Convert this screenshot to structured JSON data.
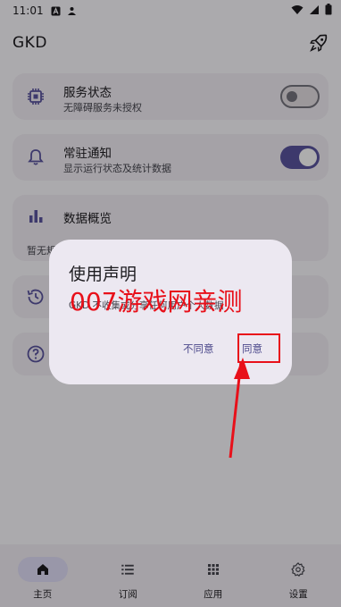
{
  "status_bar": {
    "time": "11:01"
  },
  "app_bar": {
    "title": "GKD"
  },
  "cards": {
    "service": {
      "label": "服务状态",
      "sub": "无障碍服务未授权"
    },
    "notify": {
      "label": "常驻通知",
      "sub": "显示运行状态及统计数据"
    },
    "overview": {
      "label": "数据概览",
      "sub": "暂无规"
    }
  },
  "dialog": {
    "title": "使用声明",
    "body": "GKD 不收集或分享任何用户个人数据",
    "disagree": "不同意",
    "agree": "同意"
  },
  "watermark": "007游戏网亲测",
  "bottom_nav": {
    "home": "主页",
    "subscribe": "订阅",
    "apps": "应用",
    "settings": "设置"
  },
  "colors": {
    "accent": "#5b55a0",
    "annotation_red": "#e8101a"
  }
}
